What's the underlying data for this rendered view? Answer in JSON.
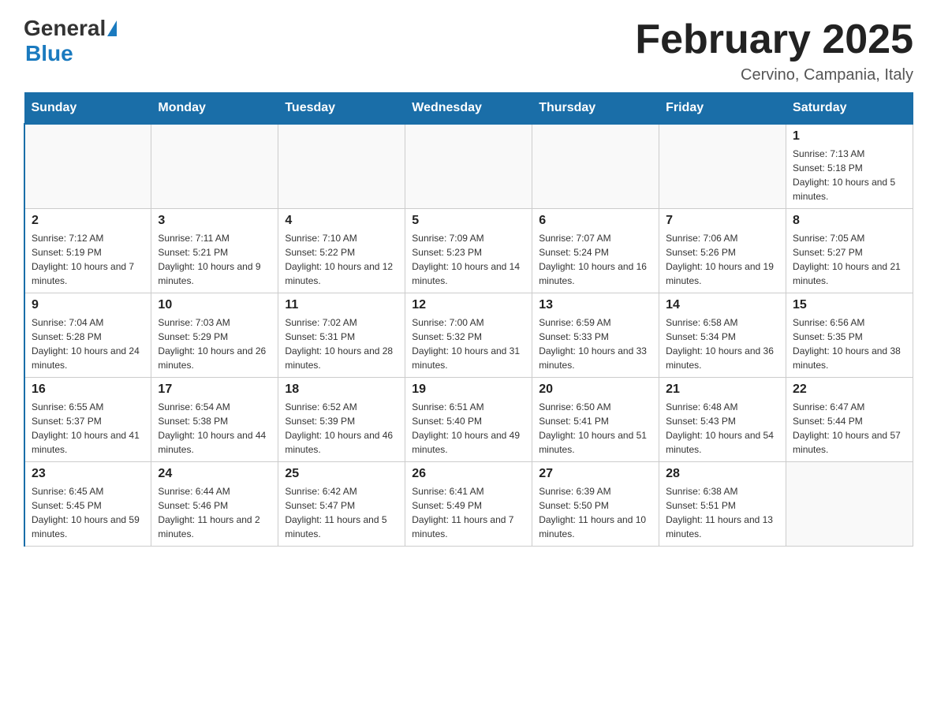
{
  "header": {
    "logo_general": "General",
    "logo_blue": "Blue",
    "month_title": "February 2025",
    "location": "Cervino, Campania, Italy"
  },
  "weekdays": [
    "Sunday",
    "Monday",
    "Tuesday",
    "Wednesday",
    "Thursday",
    "Friday",
    "Saturday"
  ],
  "weeks": [
    [
      {
        "day": "",
        "info": ""
      },
      {
        "day": "",
        "info": ""
      },
      {
        "day": "",
        "info": ""
      },
      {
        "day": "",
        "info": ""
      },
      {
        "day": "",
        "info": ""
      },
      {
        "day": "",
        "info": ""
      },
      {
        "day": "1",
        "info": "Sunrise: 7:13 AM\nSunset: 5:18 PM\nDaylight: 10 hours and 5 minutes."
      }
    ],
    [
      {
        "day": "2",
        "info": "Sunrise: 7:12 AM\nSunset: 5:19 PM\nDaylight: 10 hours and 7 minutes."
      },
      {
        "day": "3",
        "info": "Sunrise: 7:11 AM\nSunset: 5:21 PM\nDaylight: 10 hours and 9 minutes."
      },
      {
        "day": "4",
        "info": "Sunrise: 7:10 AM\nSunset: 5:22 PM\nDaylight: 10 hours and 12 minutes."
      },
      {
        "day": "5",
        "info": "Sunrise: 7:09 AM\nSunset: 5:23 PM\nDaylight: 10 hours and 14 minutes."
      },
      {
        "day": "6",
        "info": "Sunrise: 7:07 AM\nSunset: 5:24 PM\nDaylight: 10 hours and 16 minutes."
      },
      {
        "day": "7",
        "info": "Sunrise: 7:06 AM\nSunset: 5:26 PM\nDaylight: 10 hours and 19 minutes."
      },
      {
        "day": "8",
        "info": "Sunrise: 7:05 AM\nSunset: 5:27 PM\nDaylight: 10 hours and 21 minutes."
      }
    ],
    [
      {
        "day": "9",
        "info": "Sunrise: 7:04 AM\nSunset: 5:28 PM\nDaylight: 10 hours and 24 minutes."
      },
      {
        "day": "10",
        "info": "Sunrise: 7:03 AM\nSunset: 5:29 PM\nDaylight: 10 hours and 26 minutes."
      },
      {
        "day": "11",
        "info": "Sunrise: 7:02 AM\nSunset: 5:31 PM\nDaylight: 10 hours and 28 minutes."
      },
      {
        "day": "12",
        "info": "Sunrise: 7:00 AM\nSunset: 5:32 PM\nDaylight: 10 hours and 31 minutes."
      },
      {
        "day": "13",
        "info": "Sunrise: 6:59 AM\nSunset: 5:33 PM\nDaylight: 10 hours and 33 minutes."
      },
      {
        "day": "14",
        "info": "Sunrise: 6:58 AM\nSunset: 5:34 PM\nDaylight: 10 hours and 36 minutes."
      },
      {
        "day": "15",
        "info": "Sunrise: 6:56 AM\nSunset: 5:35 PM\nDaylight: 10 hours and 38 minutes."
      }
    ],
    [
      {
        "day": "16",
        "info": "Sunrise: 6:55 AM\nSunset: 5:37 PM\nDaylight: 10 hours and 41 minutes."
      },
      {
        "day": "17",
        "info": "Sunrise: 6:54 AM\nSunset: 5:38 PM\nDaylight: 10 hours and 44 minutes."
      },
      {
        "day": "18",
        "info": "Sunrise: 6:52 AM\nSunset: 5:39 PM\nDaylight: 10 hours and 46 minutes."
      },
      {
        "day": "19",
        "info": "Sunrise: 6:51 AM\nSunset: 5:40 PM\nDaylight: 10 hours and 49 minutes."
      },
      {
        "day": "20",
        "info": "Sunrise: 6:50 AM\nSunset: 5:41 PM\nDaylight: 10 hours and 51 minutes."
      },
      {
        "day": "21",
        "info": "Sunrise: 6:48 AM\nSunset: 5:43 PM\nDaylight: 10 hours and 54 minutes."
      },
      {
        "day": "22",
        "info": "Sunrise: 6:47 AM\nSunset: 5:44 PM\nDaylight: 10 hours and 57 minutes."
      }
    ],
    [
      {
        "day": "23",
        "info": "Sunrise: 6:45 AM\nSunset: 5:45 PM\nDaylight: 10 hours and 59 minutes."
      },
      {
        "day": "24",
        "info": "Sunrise: 6:44 AM\nSunset: 5:46 PM\nDaylight: 11 hours and 2 minutes."
      },
      {
        "day": "25",
        "info": "Sunrise: 6:42 AM\nSunset: 5:47 PM\nDaylight: 11 hours and 5 minutes."
      },
      {
        "day": "26",
        "info": "Sunrise: 6:41 AM\nSunset: 5:49 PM\nDaylight: 11 hours and 7 minutes."
      },
      {
        "day": "27",
        "info": "Sunrise: 6:39 AM\nSunset: 5:50 PM\nDaylight: 11 hours and 10 minutes."
      },
      {
        "day": "28",
        "info": "Sunrise: 6:38 AM\nSunset: 5:51 PM\nDaylight: 11 hours and 13 minutes."
      },
      {
        "day": "",
        "info": ""
      }
    ]
  ]
}
